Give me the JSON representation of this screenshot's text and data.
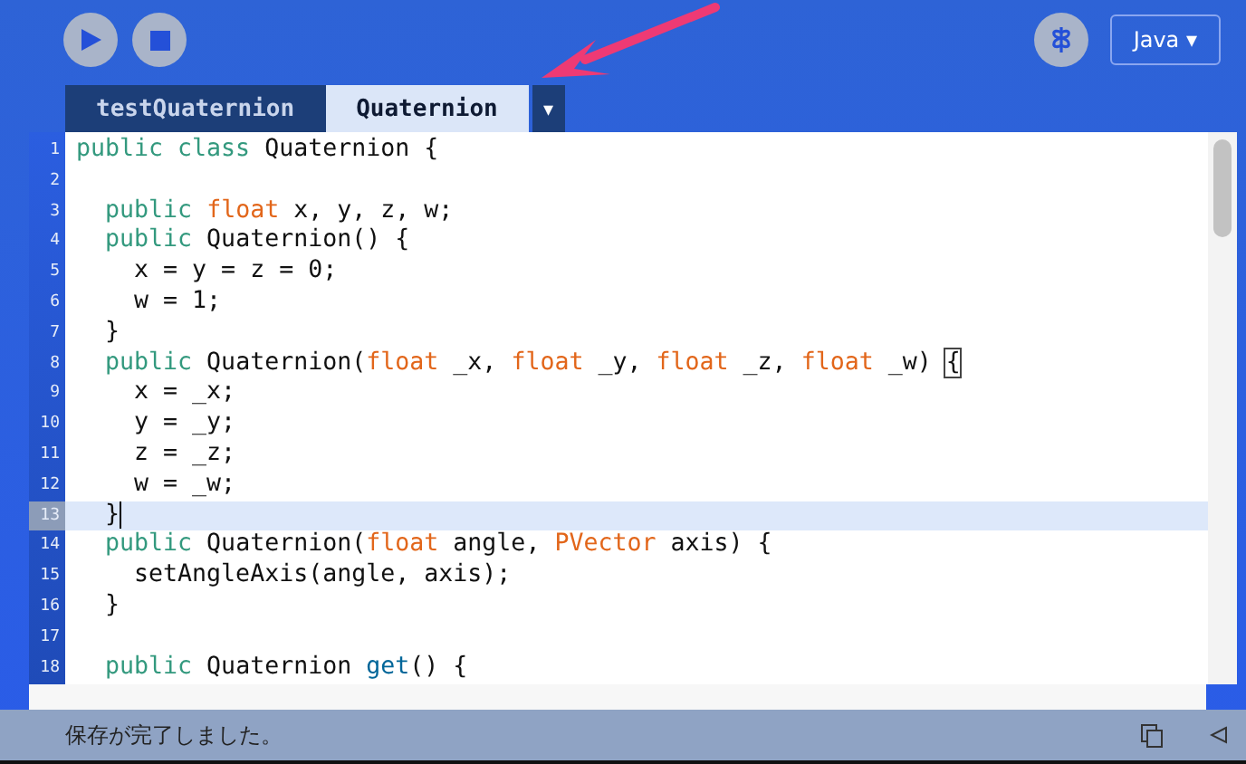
{
  "toolbar": {
    "mode_button": {
      "label": "Java ▾"
    }
  },
  "tabs": [
    {
      "label": "testQuaternion",
      "selected": false
    },
    {
      "label": "Quaternion",
      "selected": true
    }
  ],
  "tab_menu": {
    "label": "▾"
  },
  "editor": {
    "lines": [
      {
        "number": "1",
        "current": false,
        "tokens": [
          {
            "text": "public class",
            "kind": "keyword"
          },
          {
            "text": " Quaternion {",
            "kind": "plain"
          }
        ]
      },
      {
        "number": "2",
        "current": false
      },
      {
        "number": "3",
        "current": false,
        "tokens": [
          {
            "text": "  public ",
            "kind": "keyword"
          },
          {
            "text": "float",
            "kind": "type"
          },
          {
            "text": " x, y, z, w;",
            "kind": "plain"
          }
        ]
      },
      {
        "number": "4",
        "current": false,
        "tokens": [
          {
            "text": "  public",
            "kind": "keyword"
          },
          {
            "text": " Quaternion() {",
            "kind": "plain"
          }
        ]
      },
      {
        "number": "5",
        "current": false,
        "tokens": [
          {
            "text": "    x = y = z = 0;",
            "kind": "plain"
          }
        ]
      },
      {
        "number": "6",
        "current": false,
        "tokens": [
          {
            "text": "    w = 1;",
            "kind": "plain"
          }
        ]
      },
      {
        "number": "7",
        "current": false,
        "tokens": [
          {
            "text": "  }",
            "kind": "plain"
          }
        ]
      },
      {
        "number": "8",
        "current": false,
        "tokens": [
          {
            "text": "  public",
            "kind": "keyword"
          },
          {
            "text": " Quaternion(",
            "kind": "plain"
          },
          {
            "text": "float",
            "kind": "type"
          },
          {
            "text": " _x, ",
            "kind": "plain"
          },
          {
            "text": "float",
            "kind": "type"
          },
          {
            "text": " _y, ",
            "kind": "plain"
          },
          {
            "text": "float",
            "kind": "type"
          },
          {
            "text": " _z, ",
            "kind": "plain"
          },
          {
            "text": "float",
            "kind": "type"
          },
          {
            "text": " _w) ",
            "kind": "plain"
          },
          {
            "text": "{",
            "kind": "match"
          }
        ]
      },
      {
        "number": "9",
        "current": false,
        "tokens": [
          {
            "text": "    x = _x;",
            "kind": "plain"
          }
        ]
      },
      {
        "number": "10",
        "current": false,
        "tokens": [
          {
            "text": "    y = _y;",
            "kind": "plain"
          }
        ]
      },
      {
        "number": "11",
        "current": false,
        "tokens": [
          {
            "text": "    z = _z;",
            "kind": "plain"
          }
        ]
      },
      {
        "number": "12",
        "current": false,
        "tokens": [
          {
            "text": "    w = _w;",
            "kind": "plain"
          }
        ]
      },
      {
        "number": "13",
        "current": true,
        "tokens": [
          {
            "text": "  }",
            "kind": "plain"
          }
        ]
      },
      {
        "number": "14",
        "current": false,
        "tokens": [
          {
            "text": "  public",
            "kind": "keyword"
          },
          {
            "text": " Quaternion(",
            "kind": "plain"
          },
          {
            "text": "float",
            "kind": "type"
          },
          {
            "text": " angle, ",
            "kind": "plain"
          },
          {
            "text": "PVector",
            "kind": "type"
          },
          {
            "text": " axis) {",
            "kind": "plain"
          }
        ]
      },
      {
        "number": "15",
        "current": false,
        "tokens": [
          {
            "text": "    setAngleAxis(angle, axis);",
            "kind": "plain"
          }
        ]
      },
      {
        "number": "16",
        "current": false,
        "tokens": [
          {
            "text": "  }",
            "kind": "plain"
          }
        ]
      },
      {
        "number": "17",
        "current": false
      },
      {
        "number": "18",
        "current": false,
        "tokens": [
          {
            "text": "  public",
            "kind": "keyword"
          },
          {
            "text": " Quaternion ",
            "kind": "plain"
          },
          {
            "text": "get",
            "kind": "method"
          },
          {
            "text": "() {",
            "kind": "plain"
          }
        ]
      }
    ]
  },
  "status_bar": {
    "message": "保存が完了しました。"
  }
}
